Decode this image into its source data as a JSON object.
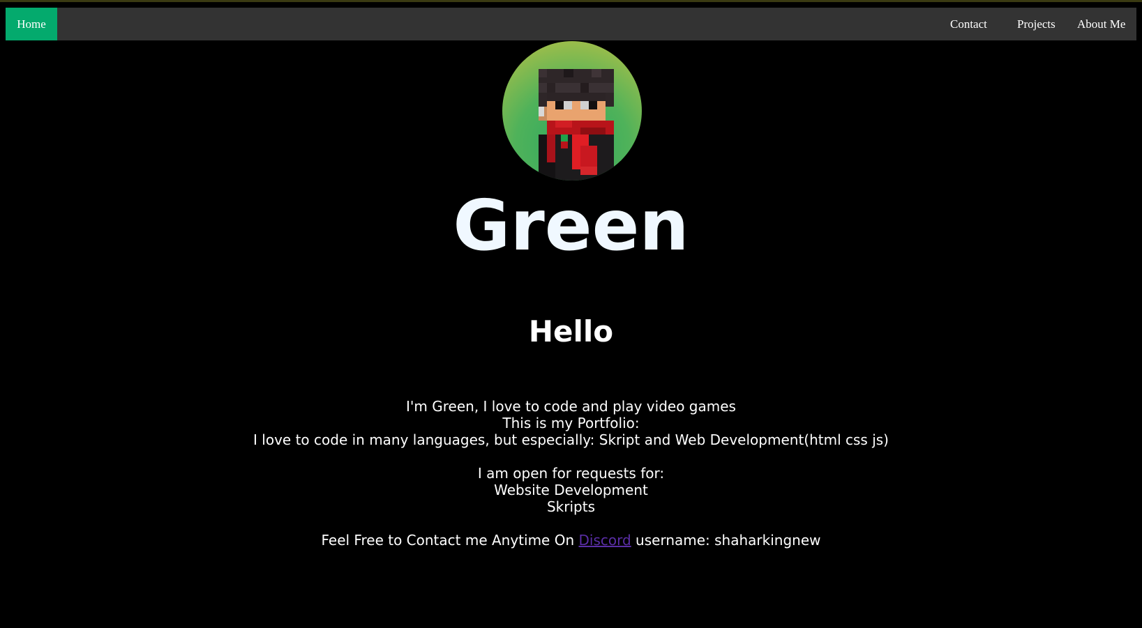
{
  "nav": {
    "home": "Home",
    "contact": "Contact",
    "projects": "Projects",
    "about": "About Me"
  },
  "profile": {
    "name": "Green",
    "greeting": "Hello"
  },
  "bio": {
    "line1": "I'm Green, I love to code and play video games",
    "line2": "This is my Portfolio:",
    "line3": "I love to code in many languages, but especially: Skript and Web Development(html css js)",
    "line4": "I am open for requests for:",
    "line5": "Website Development",
    "line6": "Skripts",
    "contact_prefix": "Feel Free to Contact me Anytime On ",
    "contact_link": "Discord",
    "contact_suffix": " username: shaharkingnew"
  },
  "colors": {
    "background": "#000000",
    "navbar": "#333333",
    "active_tab": "#04AA6D",
    "link": "#5a2ea6"
  },
  "icons": {
    "avatar": "pixel-character-avatar"
  }
}
